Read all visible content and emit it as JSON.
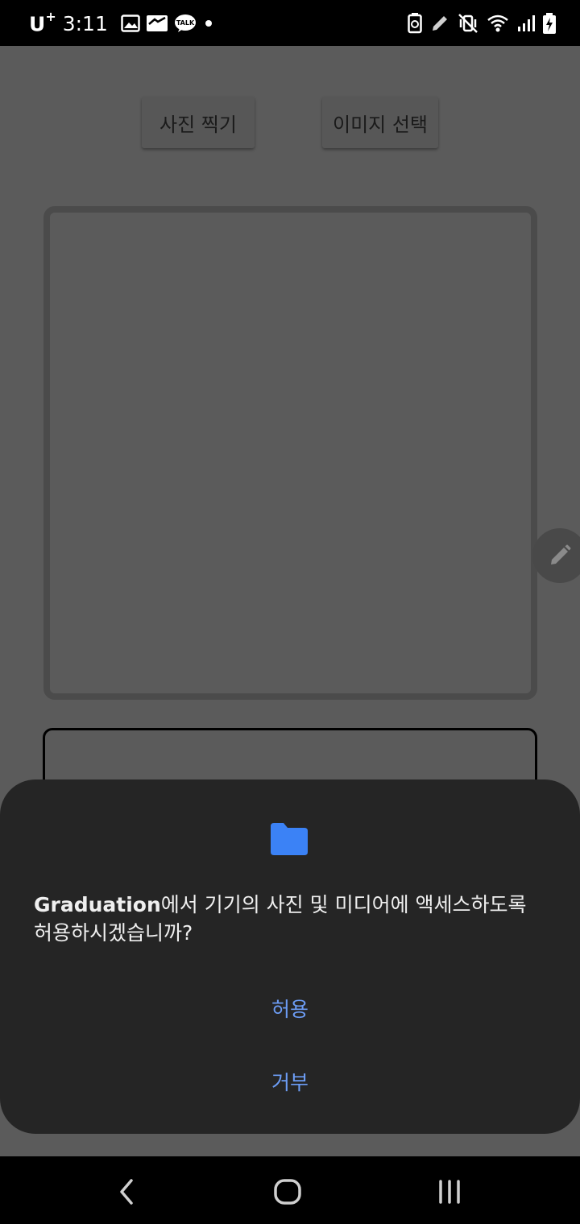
{
  "status_bar": {
    "carrier": "U",
    "carrier_sup": "+",
    "time": "3:11",
    "left_icons": [
      "image-icon",
      "mail-icon",
      "kakaotalk-icon",
      "dot-icon"
    ],
    "right_icons": [
      "battery-saver-icon",
      "pen-icon",
      "vibrate-mute-icon",
      "wifi-icon",
      "signal-icon",
      "battery-charging-icon"
    ],
    "talk_label": "TALK"
  },
  "app": {
    "take_photo_label": "사진 찍기",
    "select_image_label": "이미지 선택",
    "edit_fab_icon": "pencil-icon"
  },
  "dialog": {
    "icon": "folder-icon",
    "icon_color": "#3b82f6",
    "app_name": "Graduation",
    "message_rest": "에서 기기의 사진 및 미디어에 액세스하도록 허용하시겠습니까?",
    "allow_label": "허용",
    "deny_label": "거부",
    "action_color": "#6c9cf4"
  },
  "nav_bar": {
    "icons": [
      "back-icon",
      "home-icon",
      "recents-icon"
    ]
  }
}
